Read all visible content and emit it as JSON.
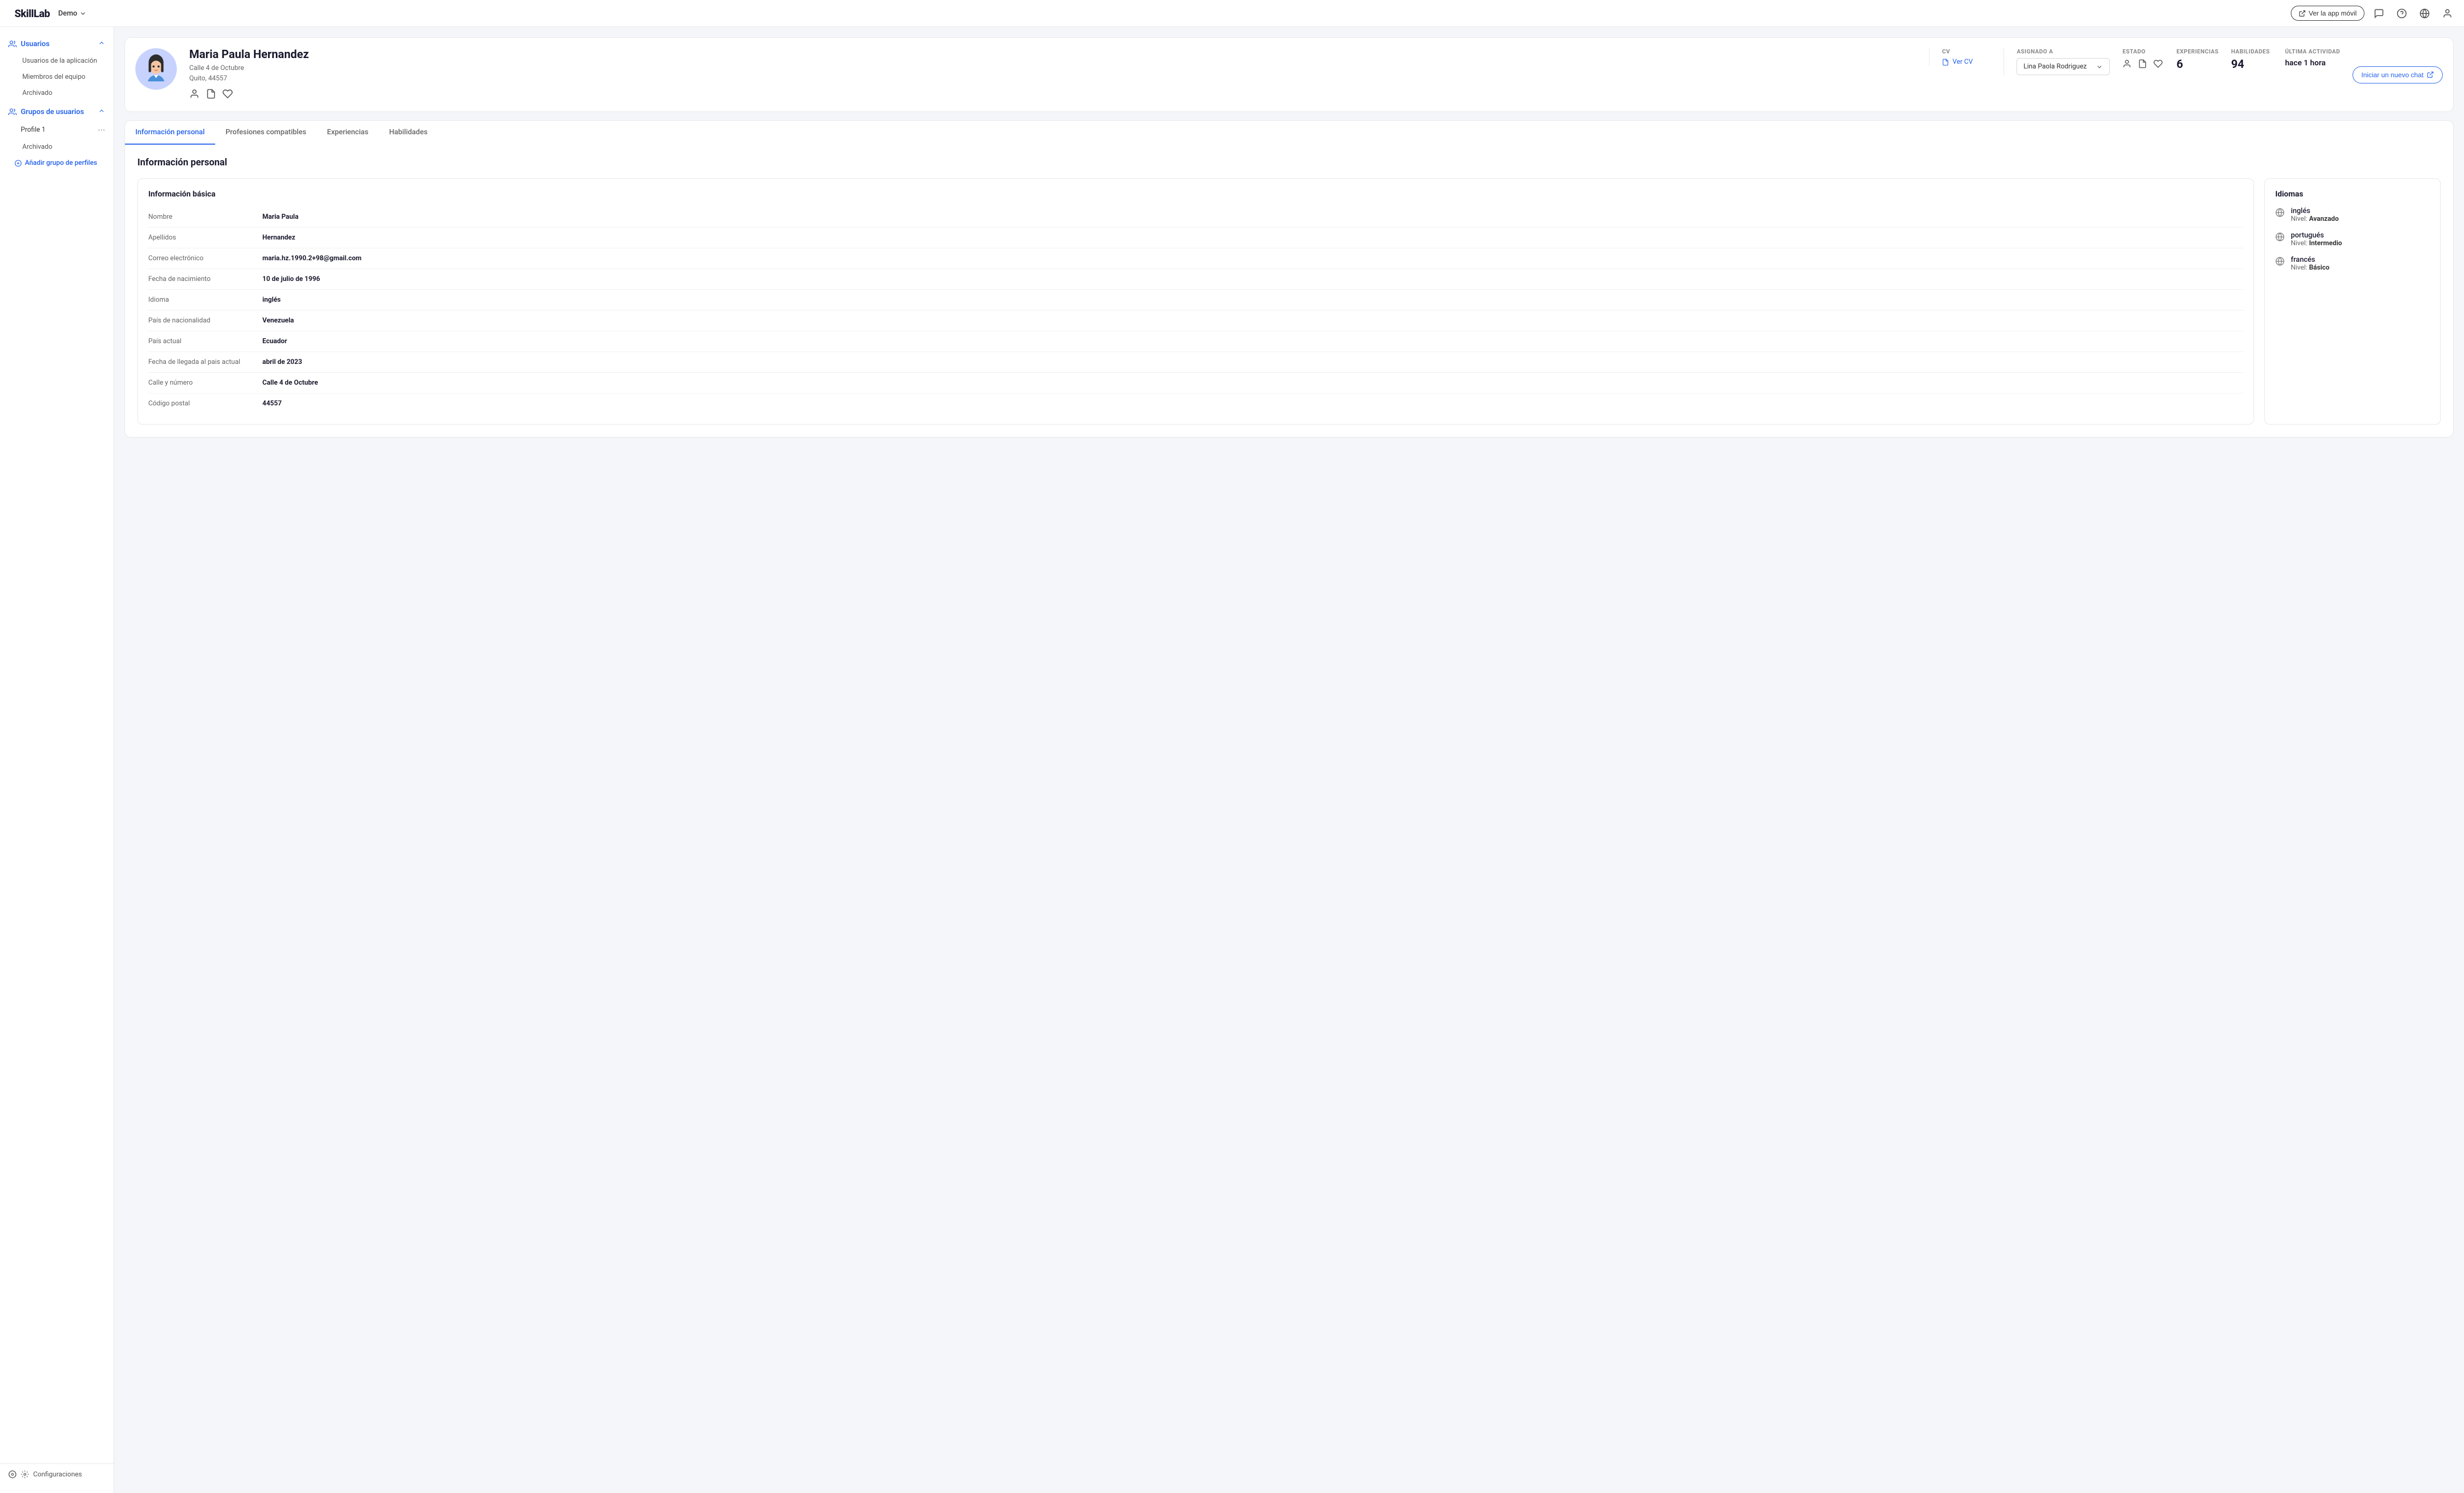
{
  "app": {
    "logo": "SkillLab",
    "workspace": "Demo",
    "topbar_btn": "Ver la app móvil"
  },
  "sidebar": {
    "usuarios_label": "Usuarios",
    "app_users": "Usuarios de la aplicación",
    "team_members": "Miembros del equipo",
    "archived_users": "Archivado",
    "grupos_label": "Grupos de usuarios",
    "profile1": "Profile 1",
    "archived_group": "Archivado",
    "add_group_label": "Añadir grupo de perfiles",
    "config_label": "Configuraciones"
  },
  "profile": {
    "name": "Maria Paula Hernandez",
    "address_line1": "Calle 4 de Octubre",
    "address_line2": "Quito, 44557",
    "cv_label": "CV",
    "cv_link": "Ver CV",
    "assigned_label": "ASIGNADO A",
    "assigned_value": "Lina Paola Rodriguez",
    "estado_label": "ESTADO",
    "experiencias_label": "EXPERIENCIAS",
    "experiencias_value": "6",
    "habilidades_label": "HABILIDADES",
    "habilidades_value": "94",
    "ultima_actividad_label": "ÚLTIMA ACTIVIDAD",
    "ultima_actividad_value": "hace 1 hora",
    "chat_btn": "Iniciar un nuevo chat"
  },
  "tabs": [
    {
      "id": "info-personal",
      "label": "Información personal",
      "active": true
    },
    {
      "id": "profesiones",
      "label": "Profesiones compatibles",
      "active": false
    },
    {
      "id": "experiencias",
      "label": "Experiencias",
      "active": false
    },
    {
      "id": "habilidades",
      "label": "Habilidades",
      "active": false
    }
  ],
  "informacion_personal": {
    "section_title": "Información personal",
    "basica_title": "Información básica",
    "rows": [
      {
        "label": "Nombre",
        "value": "Maria Paula"
      },
      {
        "label": "Apellidos",
        "value": "Hernandez"
      },
      {
        "label": "Correo electrónico",
        "value": "maria.hz.1990.2+98@gmail.com"
      },
      {
        "label": "Fecha de nacimiento",
        "value": "10 de julio de 1996"
      },
      {
        "label": "Idioma",
        "value": "inglés"
      },
      {
        "label": "País de nacionalidad",
        "value": "Venezuela"
      },
      {
        "label": "País actual",
        "value": "Ecuador"
      },
      {
        "label": "Fecha de llegada al pais actual",
        "value": "abril de 2023"
      },
      {
        "label": "Calle y número",
        "value": "Calle 4 de Octubre"
      },
      {
        "label": "Código postal",
        "value": "44557"
      }
    ],
    "idiomas_title": "Idiomas",
    "idiomas": [
      {
        "name": "inglés",
        "level_prefix": "Nivel:",
        "level": "Avanzado"
      },
      {
        "name": "portugués",
        "level_prefix": "Nivel:",
        "level": "Intermedio"
      },
      {
        "name": "francés",
        "level_prefix": "Nivel:",
        "level": "Básico"
      }
    ]
  },
  "colors": {
    "primary": "#2563eb",
    "text_dark": "#1a1a2e",
    "text_muted": "#666",
    "border": "#e5e7eb"
  }
}
